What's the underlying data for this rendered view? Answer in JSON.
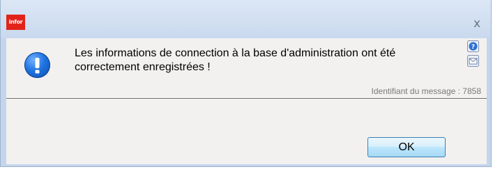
{
  "window": {
    "logo_text": "infor",
    "close_glyph": "x"
  },
  "dialog": {
    "icon": "info-exclamation-icon",
    "message_line1": "Les informations de connection à la base d'administration ont été",
    "message_line2": "correctement enregistrées !",
    "message_id": "Identifiant du message : 7858",
    "ok_label": "OK"
  },
  "side_icons": [
    "help-icon",
    "mail-icon"
  ],
  "colors": {
    "frame": "#c4d5ec",
    "panel": "#f2f1f0",
    "logo": "#e2231a",
    "info_icon": "#1f73e0"
  }
}
